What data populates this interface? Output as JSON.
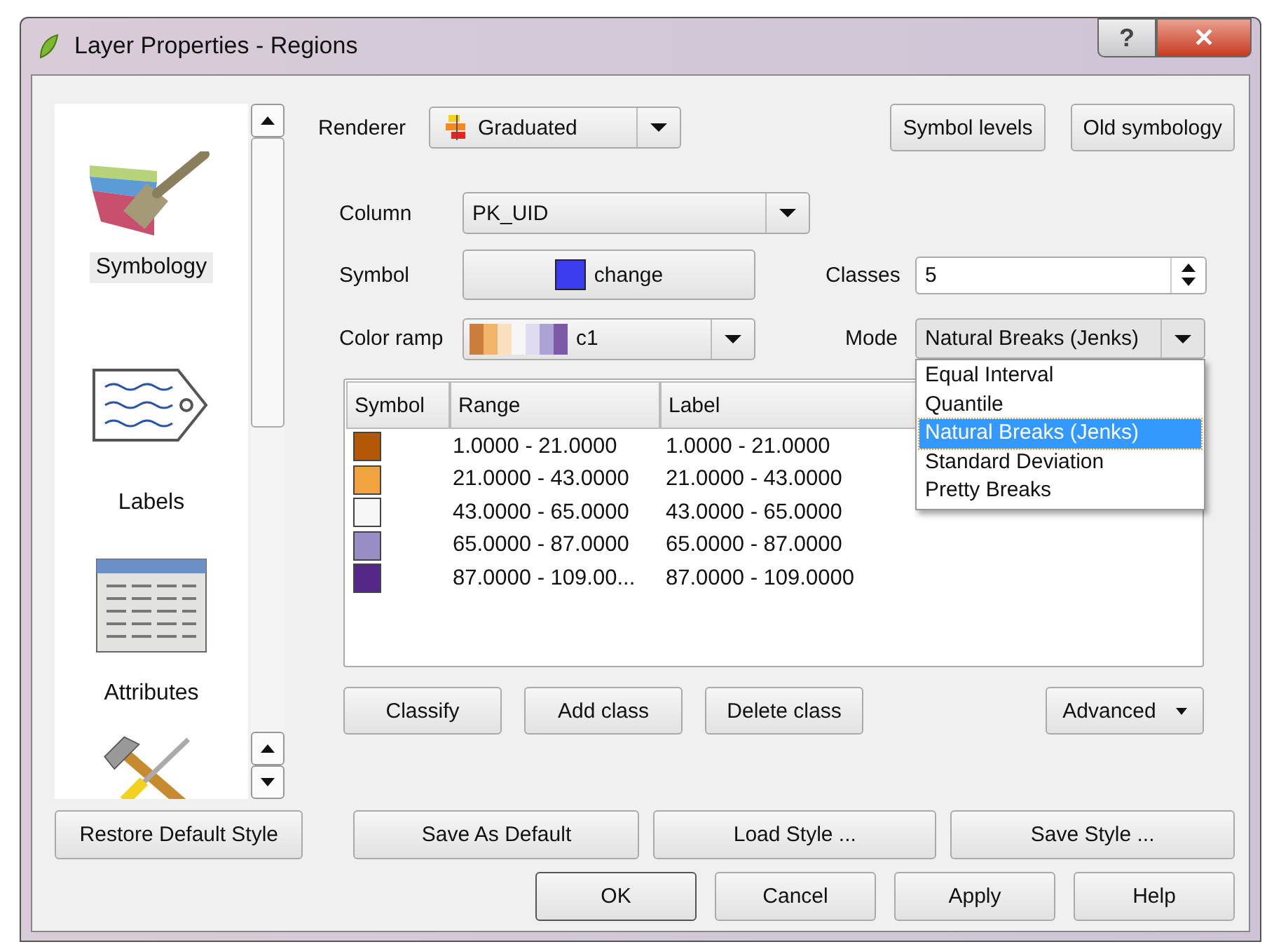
{
  "window": {
    "title": "Layer Properties - Regions",
    "help": "?",
    "close": "✕"
  },
  "sidebar": {
    "items": [
      {
        "label": "Symbology",
        "selected": true
      },
      {
        "label": "Labels",
        "selected": false
      },
      {
        "label": "Attributes",
        "selected": false
      }
    ]
  },
  "renderer": {
    "label": "Renderer",
    "value": "Graduated"
  },
  "top_buttons": [
    "Symbol levels",
    "Old symbology"
  ],
  "column": {
    "label": "Column",
    "value": "PK_UID"
  },
  "symbol": {
    "label": "Symbol",
    "button": "change",
    "color": "#3b3bf0"
  },
  "classes": {
    "label": "Classes",
    "value": "5"
  },
  "color_ramp": {
    "label": "Color ramp",
    "value": "c1"
  },
  "mode": {
    "label": "Mode",
    "value": "Natural Breaks (Jenks)",
    "expanded": true,
    "options": [
      {
        "label": "Equal Interval",
        "selected": false
      },
      {
        "label": "Quantile",
        "selected": false
      },
      {
        "label": "Natural Breaks (Jenks)",
        "selected": true
      },
      {
        "label": "Standard Deviation",
        "selected": false
      },
      {
        "label": "Pretty Breaks",
        "selected": false
      }
    ]
  },
  "table": {
    "columns": [
      "Symbol",
      "Range",
      "Label"
    ],
    "rows": [
      {
        "color": "#b35806",
        "range": "1.0000 - 21.0000",
        "label": "1.0000 - 21.0000"
      },
      {
        "color": "#f1a340",
        "range": "21.0000 - 43.0000",
        "label": "21.0000 - 43.0000"
      },
      {
        "color": "#f7f7f7",
        "range": "43.0000 - 65.0000",
        "label": "43.0000 - 65.0000"
      },
      {
        "color": "#998ec3",
        "range": "65.0000 - 87.0000",
        "label": "65.0000 - 87.0000"
      },
      {
        "color": "#542788",
        "range": "87.0000 - 109.00...",
        "label": "87.0000 - 109.0000"
      }
    ]
  },
  "class_buttons": [
    "Classify",
    "Add class",
    "Delete class"
  ],
  "advanced": "Advanced",
  "style_buttons": [
    "Restore Default Style",
    "Save As Default",
    "Load Style ...",
    "Save Style ..."
  ],
  "dialog_buttons": [
    {
      "label": "OK",
      "default": true
    },
    {
      "label": "Cancel",
      "default": false
    },
    {
      "label": "Apply",
      "default": false
    },
    {
      "label": "Help",
      "default": false
    }
  ]
}
